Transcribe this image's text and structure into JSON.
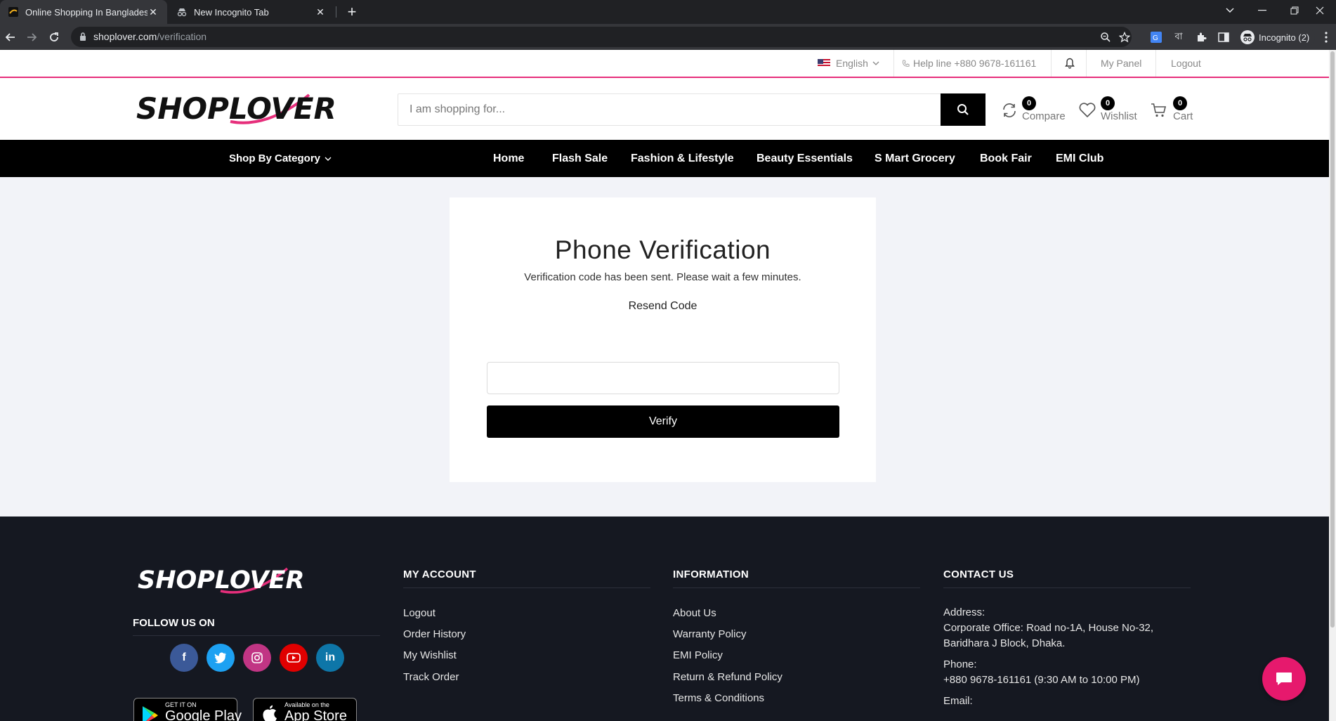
{
  "browser": {
    "tabs": [
      {
        "title": "Online Shopping In Bangladesh -",
        "active": true
      },
      {
        "title": "New Incognito Tab",
        "active": false
      }
    ],
    "url_host": "shoplover.com",
    "url_path": "/verification",
    "profile_label": "Incognito (2)"
  },
  "topbar": {
    "language": "English",
    "helpline": "Help line +880 9678-161161",
    "my_panel": "My Panel",
    "logout": "Logout"
  },
  "header": {
    "logo_text": "SHOPLOVER",
    "search_placeholder": "I am shopping for...",
    "compare": {
      "label": "Compare",
      "count": "0"
    },
    "wishlist": {
      "label": "Wishlist",
      "count": "0"
    },
    "cart": {
      "label": "Cart",
      "count": "0"
    }
  },
  "nav": {
    "category_label": "Shop By Category",
    "links": [
      "Home",
      "Flash Sale",
      "Fashion & Lifestyle",
      "Beauty Essentials",
      "S Mart Grocery",
      "Book Fair",
      "EMI Club"
    ]
  },
  "verification": {
    "title": "Phone Verification",
    "message": "Verification code has been sent. Please wait a few minutes.",
    "resend": "Resend Code",
    "code_value": "",
    "verify_label": "Verify"
  },
  "footer": {
    "logo_text": "SHOPLOVER",
    "follow_title": "FOLLOW US ON",
    "social": [
      "facebook",
      "twitter",
      "instagram",
      "youtube",
      "linkedin"
    ],
    "google_play": {
      "small": "GET IT ON",
      "big": "Google Play"
    },
    "app_store": {
      "small": "Available on the",
      "big": "App Store"
    },
    "my_account": {
      "title": "MY ACCOUNT",
      "links": [
        "Logout",
        "Order History",
        "My Wishlist",
        "Track Order"
      ]
    },
    "information": {
      "title": "INFORMATION",
      "links": [
        "About Us",
        "Warranty Policy",
        "EMI Policy",
        "Return & Refund Policy",
        "Terms & Conditions"
      ]
    },
    "contact": {
      "title": "CONTACT US",
      "address_label": "Address:",
      "address_line1": "Corporate Office: Road no-1A, House No-32,",
      "address_line2": "Baridhara J Block, Dhaka.",
      "phone_label": "Phone:",
      "phone": "+880 9678-161161 (9:30 AM to 10:00 PM)",
      "email_label": "Email:"
    }
  },
  "colors": {
    "accent": "#e62e7b",
    "nav_bg": "#000000",
    "footer_bg": "#151821",
    "page_bg": "#f2f3f8"
  }
}
